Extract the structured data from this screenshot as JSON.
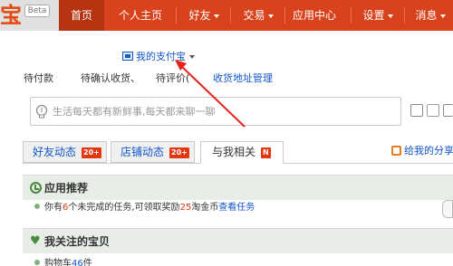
{
  "header": {
    "logo_glyph": "宝",
    "beta_label": "Beta",
    "nav": [
      {
        "label": "首页",
        "active": true
      },
      {
        "label": "个人主页",
        "active": false
      },
      {
        "label": "好友",
        "dropdown": true
      },
      {
        "label": "交易",
        "dropdown": true
      },
      {
        "label": "应用中心",
        "active": false
      },
      {
        "label": "设置",
        "dropdown": true
      },
      {
        "label": "消息",
        "dropdown": true
      }
    ],
    "nav_color": "#d8431d"
  },
  "account": {
    "alipay_label": "我的支付宝"
  },
  "order_status": {
    "pending_payment": "待付款",
    "pending_receipt": "待确认收货、",
    "pending_review": "待评价(",
    "address_manage": "收货地址管理"
  },
  "status_box": {
    "placeholder": "生活每天都有新鲜事,每天都来聊一聊"
  },
  "tabs": [
    {
      "label": "好友动态",
      "badge": "20+"
    },
    {
      "label": "店铺动态",
      "badge": "20+"
    },
    {
      "label": "与我相关",
      "badge": "N"
    }
  ],
  "share_label": "给我的分享",
  "recommend": {
    "title": "应用推荐",
    "task_prefix": "你有",
    "task_count": "6",
    "task_middle": "个未完成的任务,可领取奖励",
    "reward_amount": "25",
    "reward_suffix": "淘金币",
    "task_link": "查看任务"
  },
  "favorites": {
    "title": "我关注的宝贝",
    "cart_prefix": "购物车",
    "cart_count": "46",
    "cart_suffix": "件"
  },
  "colors": {
    "accent": "#d8431d",
    "link": "#1155cc",
    "badge": "#e4370f",
    "panel_icon": "#4a8a3c"
  }
}
